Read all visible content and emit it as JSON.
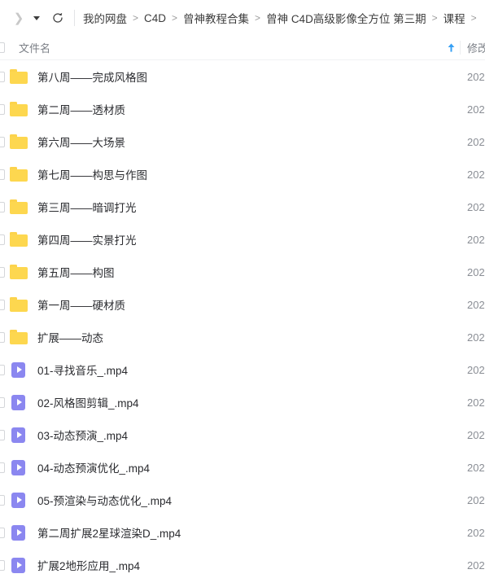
{
  "toolbar": {
    "forward_icon": "chevron-right-icon",
    "history_dropdown_icon": "caret-down-icon",
    "refresh_icon": "refresh-icon",
    "breadcrumbs": [
      {
        "label": "我的网盘"
      },
      {
        "label": "C4D"
      },
      {
        "label": "曾神教程合集"
      },
      {
        "label": "曾神 C4D高级影像全方位 第三期"
      },
      {
        "label": "课程"
      }
    ],
    "separator": ">"
  },
  "columns": {
    "name_label": "文件名",
    "mtime_label": "修改",
    "sort_indicator": "↑",
    "sort_direction": "ascending"
  },
  "colors": {
    "folder": "#fdd74f",
    "video": "#8b87f0",
    "sort_accent": "#37a0f4",
    "text": "#2b2c30",
    "muted_text": "#7b7f86"
  },
  "files": [
    {
      "name": "第八周——完成风格图",
      "type": "folder",
      "icon": "folder-icon",
      "mtime": "202"
    },
    {
      "name": "第二周——透材质",
      "type": "folder",
      "icon": "folder-icon",
      "mtime": "202"
    },
    {
      "name": "第六周——大场景",
      "type": "folder",
      "icon": "folder-icon",
      "mtime": "202"
    },
    {
      "name": "第七周——构思与作图",
      "type": "folder",
      "icon": "folder-icon",
      "mtime": "202"
    },
    {
      "name": "第三周——暗调打光",
      "type": "folder",
      "icon": "folder-icon",
      "mtime": "202"
    },
    {
      "name": "第四周——实景打光",
      "type": "folder",
      "icon": "folder-icon",
      "mtime": "202"
    },
    {
      "name": "第五周——构图",
      "type": "folder",
      "icon": "folder-icon",
      "mtime": "202"
    },
    {
      "name": "第一周——硬材质",
      "type": "folder",
      "icon": "folder-icon",
      "mtime": "202"
    },
    {
      "name": "扩展——动态",
      "type": "folder",
      "icon": "folder-icon",
      "mtime": "202"
    },
    {
      "name": "01-寻找音乐_.mp4",
      "type": "video",
      "icon": "video-file-icon",
      "mtime": "202"
    },
    {
      "name": "02-风格图剪辑_.mp4",
      "type": "video",
      "icon": "video-file-icon",
      "mtime": "202"
    },
    {
      "name": "03-动态预演_.mp4",
      "type": "video",
      "icon": "video-file-icon",
      "mtime": "202"
    },
    {
      "name": "04-动态预演优化_.mp4",
      "type": "video",
      "icon": "video-file-icon",
      "mtime": "202"
    },
    {
      "name": "05-预渲染与动态优化_.mp4",
      "type": "video",
      "icon": "video-file-icon",
      "mtime": "202"
    },
    {
      "name": "第二周扩展2星球渲染D_.mp4",
      "type": "video",
      "icon": "video-file-icon",
      "mtime": "202"
    },
    {
      "name": "扩展2地形应用_.mp4",
      "type": "video",
      "icon": "video-file-icon",
      "mtime": "202"
    }
  ]
}
